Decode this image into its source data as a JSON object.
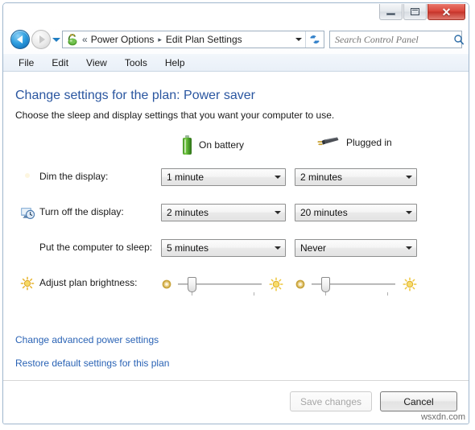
{
  "window": {
    "caption_buttons": {
      "minimize": "minimize-button",
      "maximize": "maximize-button",
      "close_label": "✕"
    }
  },
  "navbar": {
    "back_tooltip": "Back",
    "forward_tooltip": "Forward",
    "address_icon": "power-options-icon",
    "chevrons": "«",
    "breadcrumbs": [
      {
        "label": "Power Options"
      },
      {
        "label": "Edit Plan Settings"
      }
    ],
    "breadcrumb_separator": "▸",
    "refresh_icon": "refresh-icon",
    "search": {
      "placeholder": "Search Control Panel",
      "value": "",
      "icon": "search-icon"
    }
  },
  "menubar": {
    "items": [
      {
        "label": "File"
      },
      {
        "label": "Edit"
      },
      {
        "label": "View"
      },
      {
        "label": "Tools"
      },
      {
        "label": "Help"
      }
    ]
  },
  "main": {
    "title": "Change settings for the plan: Power saver",
    "subtitle": "Choose the sleep and display settings that you want your computer to use.",
    "columns": [
      {
        "label": "On battery",
        "icon": "battery-icon"
      },
      {
        "label": "Plugged in",
        "icon": "power-plug-icon"
      }
    ],
    "rows": [
      {
        "icon": "dim-display-icon",
        "label": "Dim the display:",
        "on_battery": "1 minute",
        "plugged_in": "2 minutes"
      },
      {
        "icon": "turn-off-display-icon",
        "label": "Turn off the display:",
        "on_battery": "2 minutes",
        "plugged_in": "20 minutes"
      },
      {
        "icon": "sleep-icon",
        "label": "Put the computer to sleep:",
        "on_battery": "5 minutes",
        "plugged_in": "Never"
      }
    ],
    "brightness": {
      "icon": "brightness-icon",
      "label": "Adjust plan brightness:",
      "low_icon": "dim-sun-icon",
      "high_icon": "bright-sun-icon",
      "on_battery_percent": 12,
      "plugged_in_percent": 12
    },
    "links": [
      {
        "label": "Change advanced power settings"
      },
      {
        "label": "Restore default settings for this plan"
      }
    ],
    "buttons": {
      "save": {
        "label": "Save changes",
        "enabled": false
      },
      "cancel": {
        "label": "Cancel",
        "enabled": true
      }
    }
  },
  "watermark": "wsxdn.com",
  "colors": {
    "title_blue": "#2a56a0",
    "link_blue": "#2a63b5",
    "battery_green": "#4fa52c",
    "close_red": "#d9453a"
  }
}
